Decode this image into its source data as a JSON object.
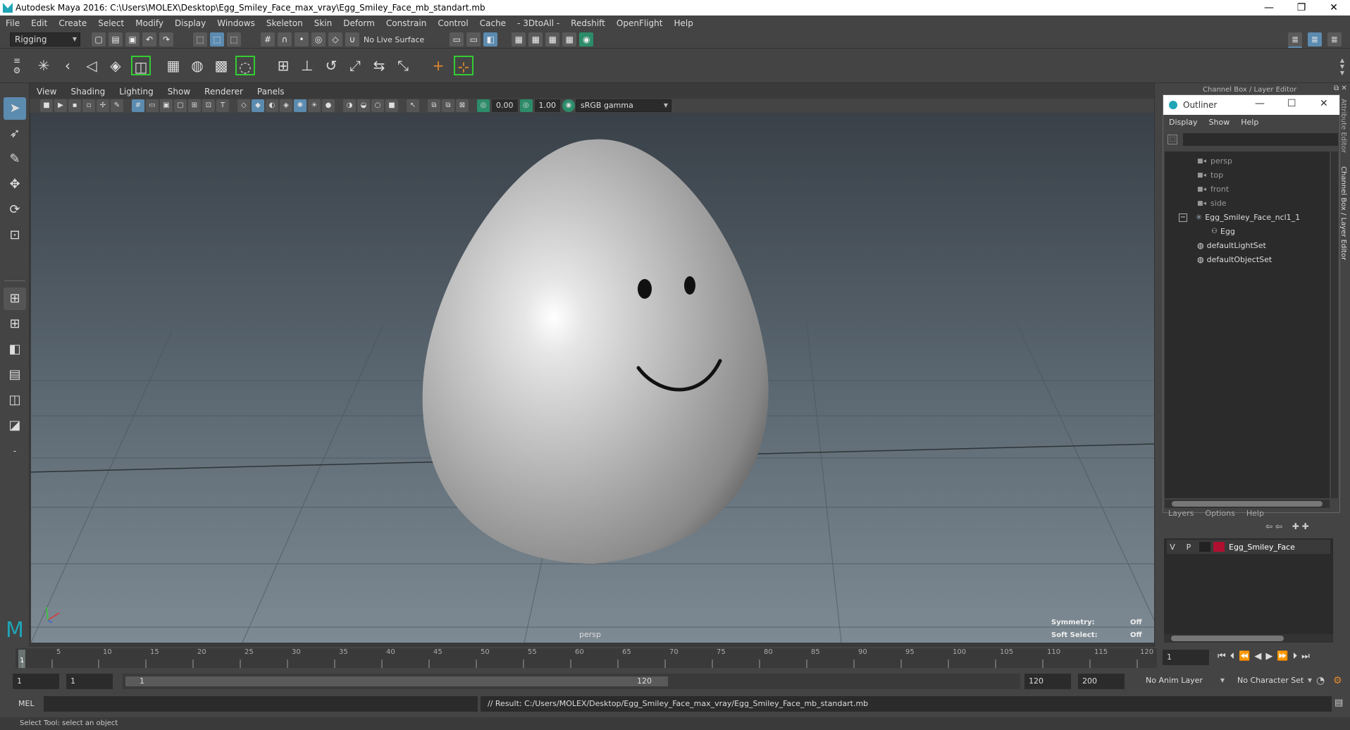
{
  "window": {
    "title": "Autodesk Maya 2016: C:\\Users\\MOLEX\\Desktop\\Egg_Smiley_Face_max_vray\\Egg_Smiley_Face_mb_standart.mb",
    "minimize": "—",
    "restore": "❐",
    "close": "✕"
  },
  "menubar": [
    "File",
    "Edit",
    "Create",
    "Select",
    "Modify",
    "Display",
    "Windows",
    "Skeleton",
    "Skin",
    "Deform",
    "Constrain",
    "Control",
    "Cache",
    "- 3DtoAll -",
    "Redshift",
    "OpenFlight",
    "Help"
  ],
  "statusline": {
    "menuset": "Rigging",
    "live_surface": "No Live Surface"
  },
  "viewport": {
    "menu": [
      "View",
      "Shading",
      "Lighting",
      "Show",
      "Renderer",
      "Panels"
    ],
    "exposure": "0.00",
    "gamma": "1.00",
    "colorspace": "sRGB gamma",
    "camera_label": "persp",
    "symmetry_label": "Symmetry:",
    "symmetry_value": "Off",
    "soft_select_label": "Soft Select:",
    "soft_select_value": "Off"
  },
  "rightpanel": {
    "header": "Channel Box / Layer Editor",
    "side_tab_1": "Attribute Editor",
    "side_tab_2": "Channel Box / Layer Editor"
  },
  "outliner": {
    "title": "Outliner",
    "menu": [
      "Display",
      "Show",
      "Help"
    ],
    "items": [
      {
        "label": "persp",
        "icon": "camera-icon",
        "dim": true
      },
      {
        "label": "top",
        "icon": "camera-icon",
        "dim": true
      },
      {
        "label": "front",
        "icon": "camera-icon",
        "dim": true
      },
      {
        "label": "side",
        "icon": "camera-icon",
        "dim": true
      },
      {
        "label": "Egg_Smiley_Face_ncl1_1",
        "icon": "group-icon",
        "dim": false
      },
      {
        "label": "Egg",
        "icon": "mesh-icon",
        "dim": false
      },
      {
        "label": "defaultLightSet",
        "icon": "set-icon",
        "dim": false
      },
      {
        "label": "defaultObjectSet",
        "icon": "set-icon",
        "dim": false
      }
    ]
  },
  "layers": {
    "menu": [
      "Layers",
      "Options",
      "Help"
    ],
    "row": {
      "v": "V",
      "p": "P",
      "name": "Egg_Smiley_Face",
      "color": "#b01030"
    }
  },
  "timeline": {
    "ticks": [
      "1",
      "5",
      "10",
      "15",
      "20",
      "25",
      "30",
      "35",
      "40",
      "45",
      "50",
      "55",
      "60",
      "65",
      "70",
      "75",
      "80",
      "85",
      "90",
      "95",
      "100",
      "105",
      "110",
      "115",
      "120"
    ],
    "current_frame": "1"
  },
  "range": {
    "start": "1",
    "playback_start": "1",
    "slider_start": "1",
    "slider_end": "120",
    "playback_end": "120",
    "end": "200",
    "anim_layer": "No Anim Layer",
    "character_set": "No Character Set"
  },
  "cmdline": {
    "lang": "MEL",
    "result": "// Result: C:/Users/MOLEX/Desktop/Egg_Smiley_Face_max_vray/Egg_Smiley_Face_mb_standart.mb"
  },
  "helpline": "Select Tool: select an object"
}
